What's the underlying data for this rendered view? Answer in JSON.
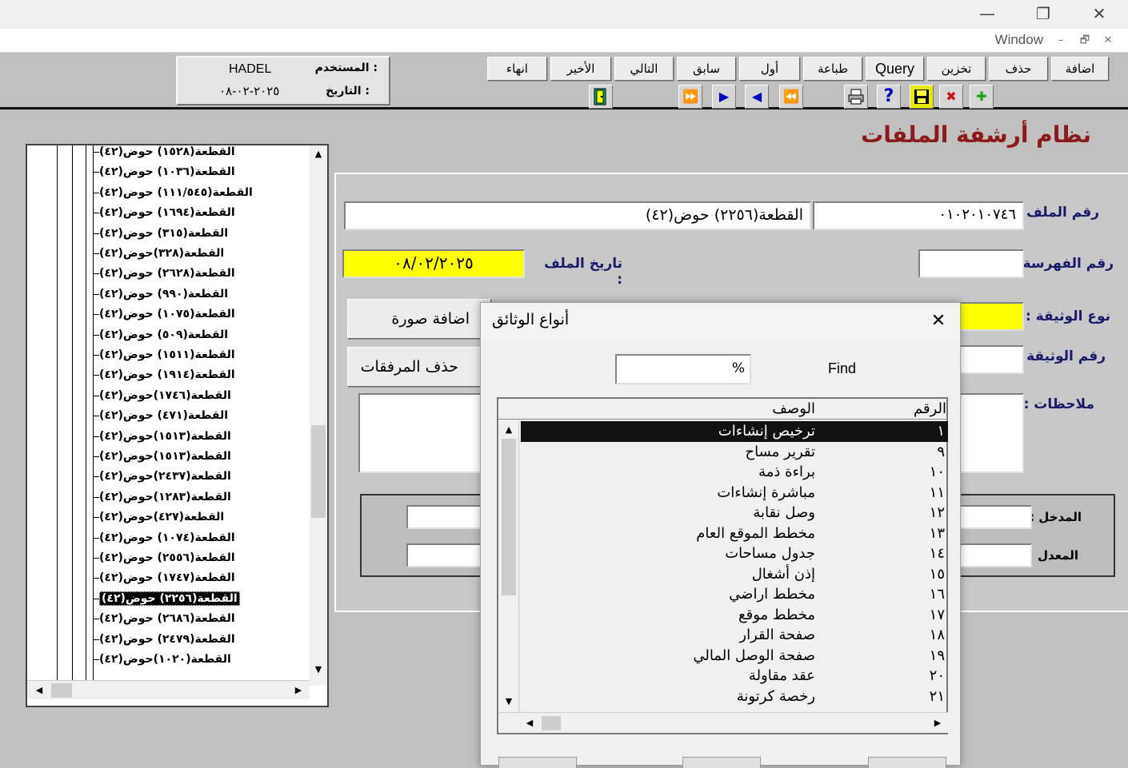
{
  "window": {
    "minimize_glyph": "—",
    "maximize_glyph": "❐",
    "close_glyph": "✕"
  },
  "menu": {
    "window_label": "Window",
    "mdi_min": "–",
    "mdi_restore": "🗗",
    "mdi_close": "✕"
  },
  "toolbar": {
    "buttons": [
      {
        "label": "اضافة"
      },
      {
        "label": "حذف"
      },
      {
        "label": "تخزين"
      },
      {
        "label": "Query"
      },
      {
        "label": "طباعة"
      },
      {
        "label": "أول"
      },
      {
        "label": "سابق"
      },
      {
        "label": "التالي"
      },
      {
        "label": "الأخير"
      },
      {
        "label": "انهاء"
      }
    ],
    "icons": [
      {
        "name": "add-icon",
        "glyph": "✚",
        "color": "#1aa01a"
      },
      {
        "name": "delete-icon",
        "glyph": "✖",
        "color": "#d01010"
      },
      {
        "name": "save-icon",
        "glyph": "💾",
        "color": "#000000"
      },
      {
        "name": "help-icon",
        "glyph": "?",
        "color": "#0000c0"
      },
      {
        "name": "print-icon",
        "glyph": "🖶",
        "color": "#000000"
      },
      {
        "name": "first-record-icon",
        "glyph": "⏪",
        "color": "#0000c0"
      },
      {
        "name": "previous-record-icon",
        "glyph": "◀",
        "color": "#0000c0"
      },
      {
        "name": "next-record-icon",
        "glyph": "▶",
        "color": "#0000c0"
      },
      {
        "name": "last-record-icon",
        "glyph": "⏩",
        "color": "#0000c0"
      },
      {
        "name": "exit-door-icon",
        "glyph": "🚪",
        "color": "#006060"
      }
    ]
  },
  "user": {
    "user_label": "المستخدم  :",
    "user_value": "HADEL",
    "date_label": "التاريخ  :",
    "date_value": "٢٠٢٥-٠٢-٠٨"
  },
  "app_title": "نظام أرشفة الملفات",
  "tree": {
    "items": [
      "القطعة(١٥٢٨) حوض(٤٢)",
      "القطعة(١٠٣٦) حوض(٤٢)",
      "القطعة(١١١/٥٤٥) حوض(٤٢)",
      "القطعة(١٦٩٤) حوض(٤٢)",
      "القطعة(٣١٥) حوض(٤٢)",
      "القطعة(٣٢٨)حوض(٤٢)",
      "القطعة(٢٦٢٨) حوض(٤٢)",
      "القطعة(٩٩٠) حوض(٤٢)",
      "القطعة(١٠٧٥) حوض(٤٢)",
      "القطعة(٥٠٩) حوض(٤٢)",
      "القطعة(١٥١١) حوض(٤٢)",
      "القطعة(١٩١٤) حوض(٤٢)",
      "القطعة(١٧٤٦)حوض(٤٢)",
      "القطعة(٤٧١) حوض(٤٢)",
      "القطعة(١٥١٣)حوض(٤٢)",
      "القطعة(١٥١٣)حوض(٤٢)",
      "القطعة(٢٤٣٧)حوض(٤٢)",
      "القطعة(١٢٨٣)حوض(٤٢)",
      "القطعة(٤٢٧)حوض(٤٢)",
      "القطعة(١٠٧٤) حوض(٤٢)",
      "القطعة(٢٥٥٦) حوض(٤٢)",
      "القطعة(١٧٤٧) حوض(٤٢)",
      "القطعة(٢٢٥٦) حوض(٤٢)",
      "القطعة(٢٦٨٦) حوض(٤٢)",
      "القطعة(٢٤٧٩) حوض(٤٢)",
      "القطعة(١٠٢٠)حوض(٤٢)"
    ],
    "selected_index": 22
  },
  "form": {
    "file_no_label": "رقم الملف :",
    "file_no_value": "٠١٠٢٠١٠٧٤٦",
    "file_name_value": "القطعة(٢٢٥٦) حوض(٤٢)",
    "index_no_label": "رقم الفهرسة :",
    "file_date_label": "تاريخ الملف :",
    "file_date_value": "٠٨/٠٢/٢٠٢٥",
    "doc_type_label": "نوع الوثيقة :",
    "doc_no_label": "رقم الوثيقة :",
    "notes_label": "ملاحظات :",
    "add_image_button": "اضافة صورة",
    "delete_attachments_button": "حذف المرفقات",
    "entered_by_label": "المدخل :",
    "modified_by_label": "المعدل :"
  },
  "dialog": {
    "title": "أنواع الوثائق",
    "close_glyph": "✕",
    "find_label": "Find",
    "find_value": "%",
    "col_num": "الرقم",
    "col_desc": "الوصف",
    "rows": [
      {
        "num": "١",
        "desc": "ترخيص إنشاءات"
      },
      {
        "num": "٩",
        "desc": "تقرير مساح"
      },
      {
        "num": "١٠",
        "desc": "براءة ذمة"
      },
      {
        "num": "١١",
        "desc": "مباشرة إنشاءات"
      },
      {
        "num": "١٢",
        "desc": "وصل نقابة"
      },
      {
        "num": "١٣",
        "desc": "مخطط الموقع العام"
      },
      {
        "num": "١٤",
        "desc": "جدول مساحات"
      },
      {
        "num": "١٥",
        "desc": "إذن أشغال"
      },
      {
        "num": "١٦",
        "desc": "مخطط اراضي"
      },
      {
        "num": "١٧",
        "desc": "مخطط موقع"
      },
      {
        "num": "١٨",
        "desc": "صفحة القرار"
      },
      {
        "num": "١٩",
        "desc": "صفحة الوصل المالي"
      },
      {
        "num": "٢٠",
        "desc": "عقد مقاولة"
      },
      {
        "num": "٢١",
        "desc": "رخصة كرتونة"
      }
    ],
    "selected_index": 0
  },
  "scroll": {
    "up": "▲",
    "down": "▼",
    "left": "◀",
    "right": "▶"
  },
  "colors": {
    "yellow_field": "#ffff00",
    "title_red": "#8b1a1a",
    "label_blue": "#1a1a6a"
  }
}
